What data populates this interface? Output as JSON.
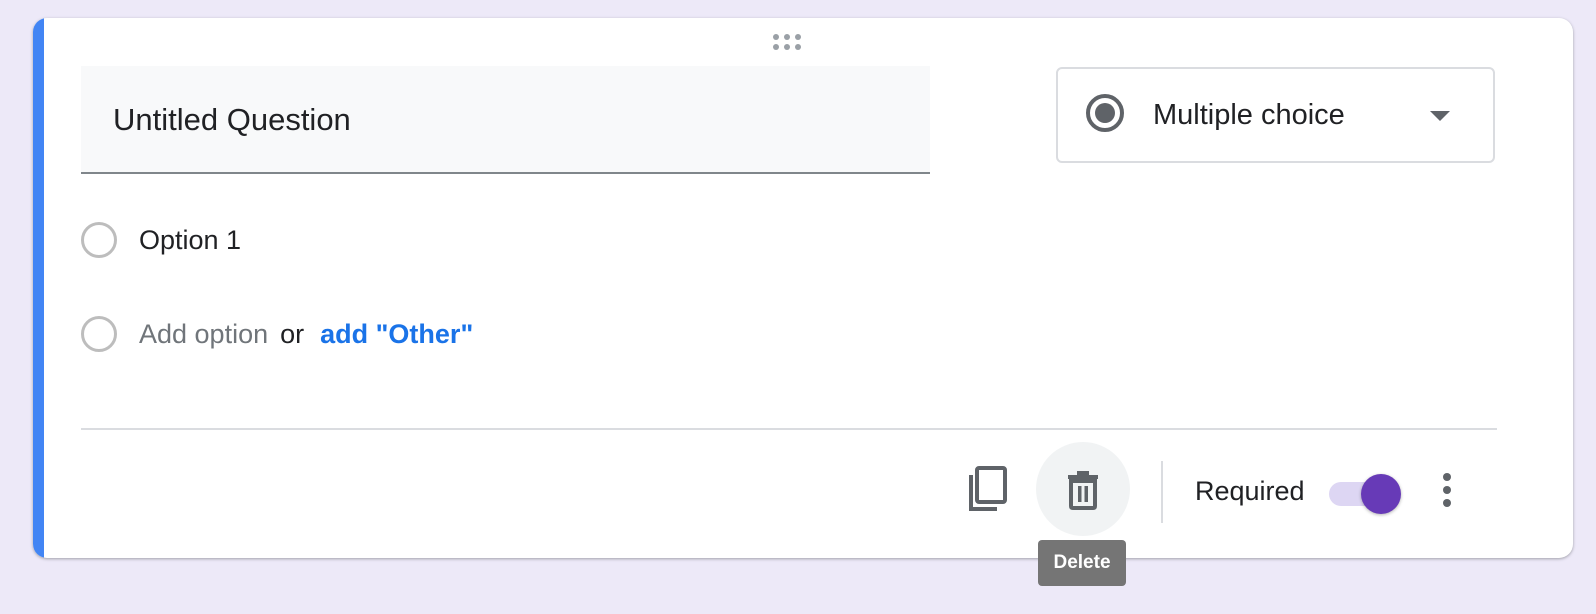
{
  "question": {
    "title_value": "Untitled Question",
    "type_label": "Multiple choice",
    "options": [
      "Option 1"
    ],
    "add_option_label": "Add option",
    "or_label": "or",
    "add_other_label": "add \"Other\""
  },
  "footer": {
    "required_label": "Required",
    "required_on": true,
    "delete_tooltip": "Delete"
  },
  "icons": {
    "drag": "drag-handle-icon",
    "type": "radio-button-checked-icon",
    "caret": "arrow-drop-down-icon",
    "copy": "content-copy-icon",
    "delete": "trash-icon",
    "more": "more-vert-icon"
  },
  "colors": {
    "accent": "#4285f4",
    "link": "#1a73e8",
    "toggle_on": "#673ab7",
    "background": "#ede9f8"
  }
}
